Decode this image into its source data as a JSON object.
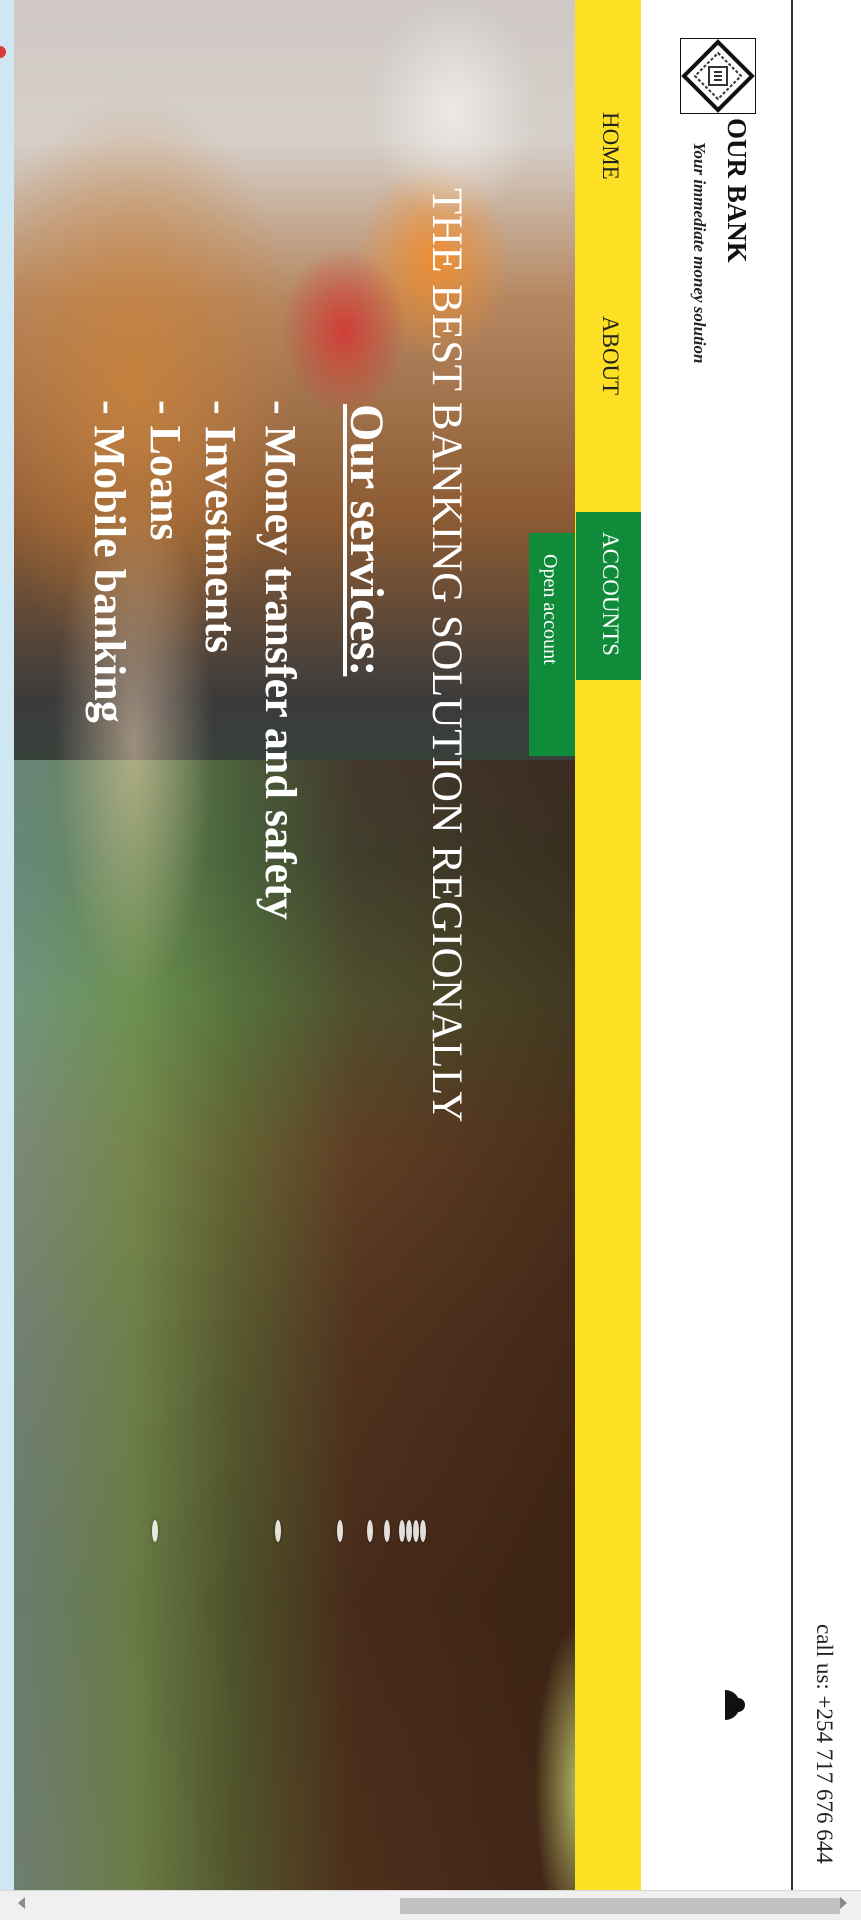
{
  "brand": {
    "name": "OUR BANK",
    "tagline": "Your immediate money solution"
  },
  "contact": {
    "phone_label": "call us: +254 717 676 644"
  },
  "nav": {
    "items": [
      {
        "label": "HOME"
      },
      {
        "label": "ABOUT"
      },
      {
        "label": "ACCOUNTS",
        "active": true
      }
    ],
    "dropdown": {
      "items": [
        {
          "label": "Open account"
        }
      ]
    }
  },
  "hero": {
    "headline": "THE BEST BANKING SOLUTION REGIONALLY",
    "services_title": "Our services:",
    "services": [
      "- Money transfer and safety",
      "- Investments",
      "- Loans",
      "- Mobile banking"
    ]
  },
  "colors": {
    "nav_background": "#fde023",
    "nav_active": "#108b3a",
    "hero_text": "#ffffff"
  },
  "icons": {
    "logo": "bank-logo-icon",
    "user": "user-icon",
    "scroll_left": "arrow-left-icon",
    "scroll_right": "arrow-right-icon"
  }
}
